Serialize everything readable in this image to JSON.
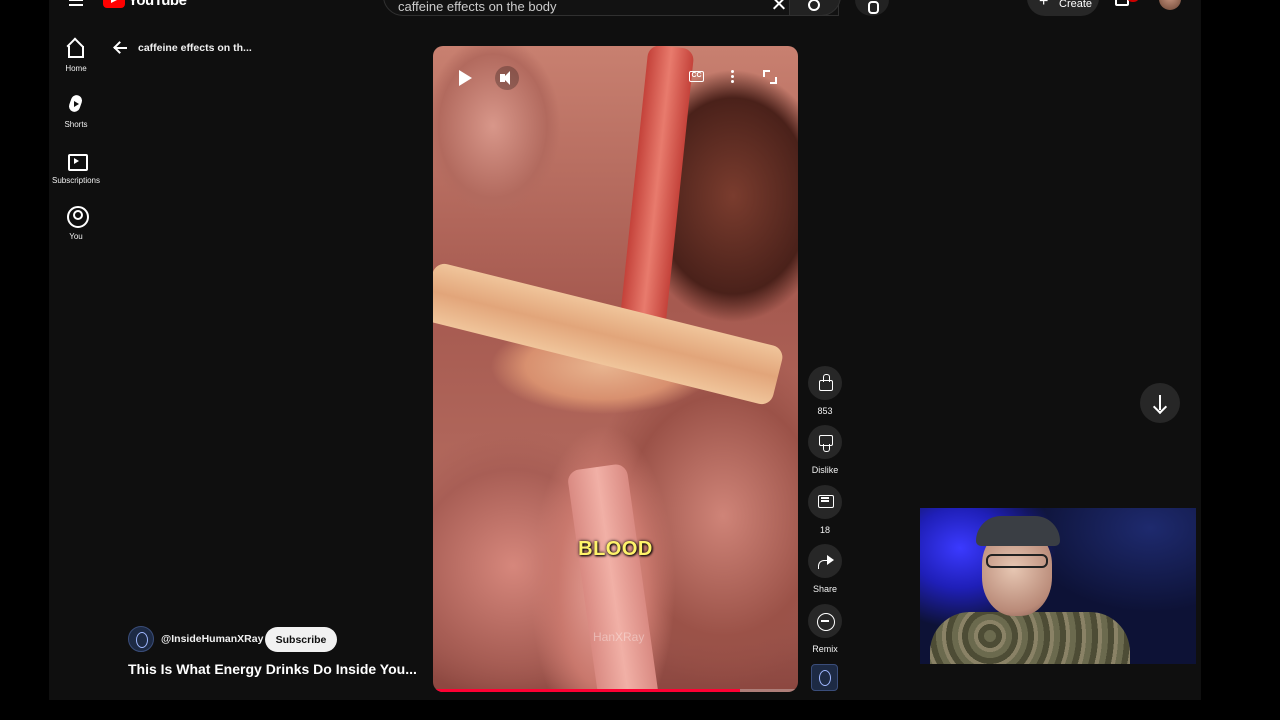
{
  "header": {
    "logo_text": "YouTube",
    "search_value": "caffeine effects on the body",
    "create_label": "Create"
  },
  "nav": {
    "items": [
      {
        "label": "Home",
        "icon": "home-icon"
      },
      {
        "label": "Shorts",
        "icon": "shorts-icon"
      },
      {
        "label": "Subscriptions",
        "icon": "subscriptions-icon"
      },
      {
        "label": "You",
        "icon": "you-icon"
      }
    ]
  },
  "back": {
    "title": "caffeine effects on th..."
  },
  "short": {
    "caption": "BLOOD",
    "watermark": "HanXRay",
    "channel": "@InsideHumanXRay",
    "subscribe_label": "Subscribe",
    "title": "This Is What Energy Drinks Do Inside You...",
    "cc_label": "CC"
  },
  "actions": {
    "like_count": "853",
    "dislike_label": "Dislike",
    "comment_count": "18",
    "share_label": "Share",
    "remix_label": "Remix"
  },
  "colors": {
    "background": "#0f0f0f",
    "caption": "#fff36b",
    "progress": "#ff0033",
    "brand": "#ff0000"
  }
}
